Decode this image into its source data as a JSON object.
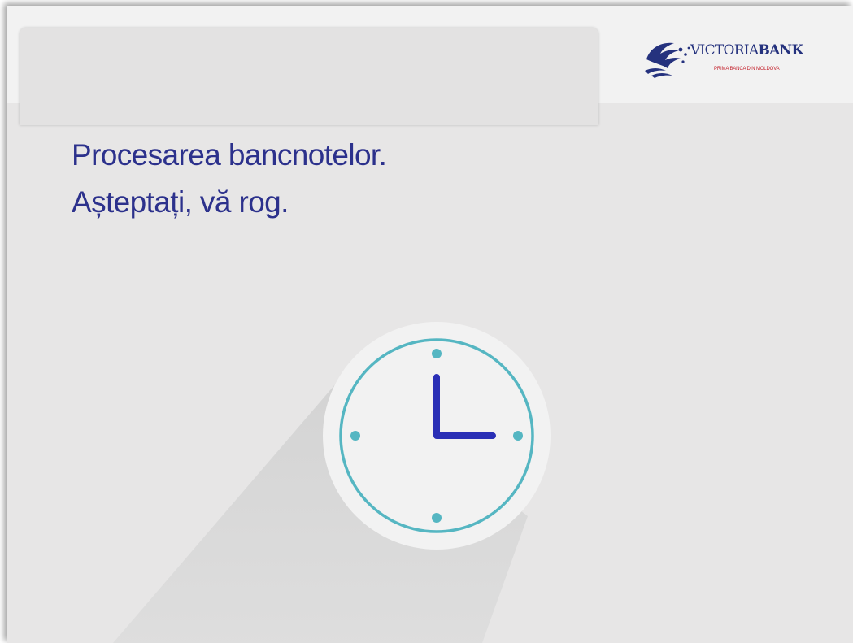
{
  "brand": {
    "name_part1": "VICTORIA",
    "name_part2": "BANK",
    "tagline": "PRIMA BANCA DIN MOLDOVA",
    "logo_icon": "bird-logo-icon",
    "primary_color": "#25327e",
    "accent_color": "#c4242f"
  },
  "message": {
    "line1": "Procesarea bancnotelor.",
    "line2": "Așteptați, vă rog."
  },
  "indicator": {
    "icon": "clock-icon",
    "ring_color": "#55b6c2",
    "hand_color": "#2a2fb6",
    "face_color": "#f2f2f2"
  }
}
